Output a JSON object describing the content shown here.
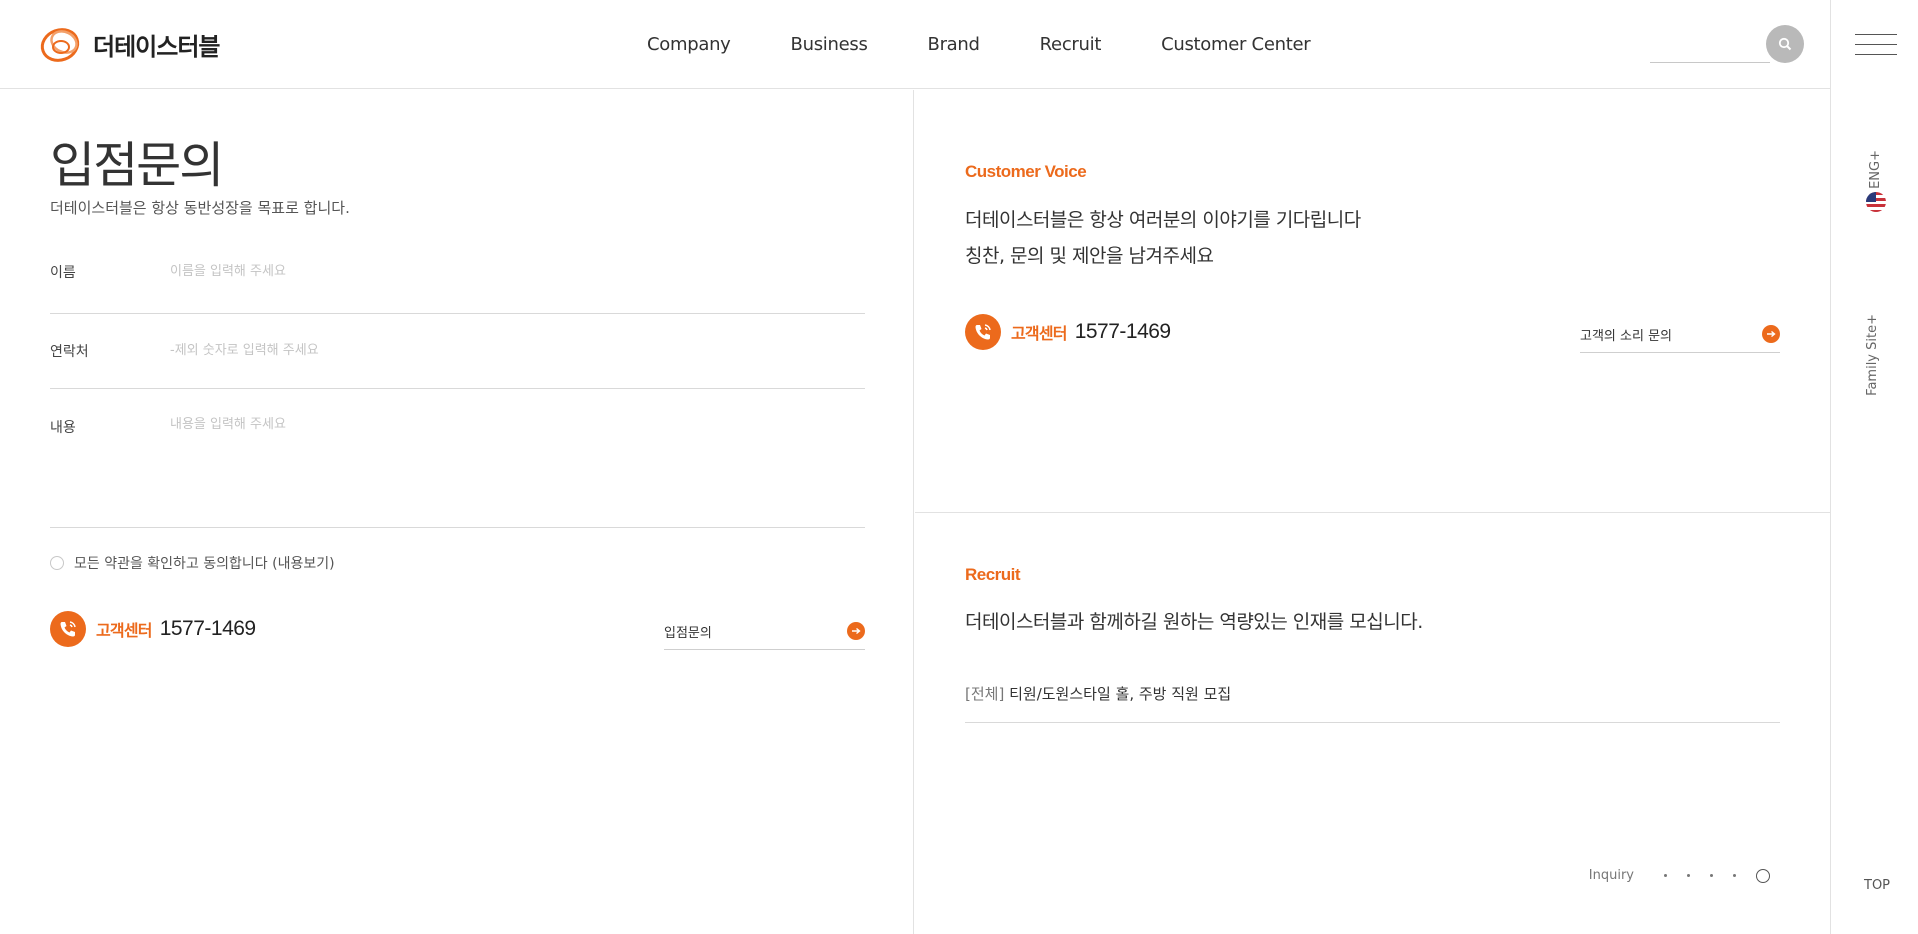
{
  "header": {
    "logo_text": "더테이스터블",
    "nav": [
      "Company",
      "Business",
      "Brand",
      "Recruit",
      "Customer Center"
    ],
    "search_placeholder": ""
  },
  "rail": {
    "eng_label": "ENG+",
    "family_label": "Family Site+",
    "top_label": "TOP"
  },
  "inquiry": {
    "title": "입점문의",
    "subtitle": "더테이스터블은 항상 동반성장을 목표로 합니다.",
    "fields": [
      {
        "label": "이름",
        "placeholder": "이름을 입력해 주세요"
      },
      {
        "label": "연락처",
        "placeholder": "-제외 숫자로 입력해 주세요"
      },
      {
        "label": "내용",
        "placeholder": "내용을 입력해 주세요"
      }
    ],
    "agree_text": "모든 약관을 확인하고 동의합니다 (내용보기)",
    "cs_label": "고객센터",
    "cs_number": "1577-1469",
    "submit_label": "입점문의"
  },
  "customer_voice": {
    "title": "Customer Voice",
    "line1": "더테이스터블은 항상 여러분의 이야기를 기다립니다",
    "line2": "칭찬, 문의 및 제안을 남겨주세요",
    "cs_label": "고객센터",
    "cs_number": "1577-1469",
    "link_label": "고객의 소리 문의"
  },
  "recruit": {
    "title": "Recruit",
    "desc": "더테이스터블과 함께하길 원하는 역량있는 인재를 모십니다.",
    "post_tag": "[전체]",
    "post_title": "티원/도원스타일 홀, 주방 직원 모집"
  },
  "pager": {
    "label": "Inquiry",
    "count": 5,
    "active_index": 5
  },
  "colors": {
    "accent": "#ec6a1c",
    "search_button": "#b9b9b9",
    "divider": "#e2e2e2"
  }
}
